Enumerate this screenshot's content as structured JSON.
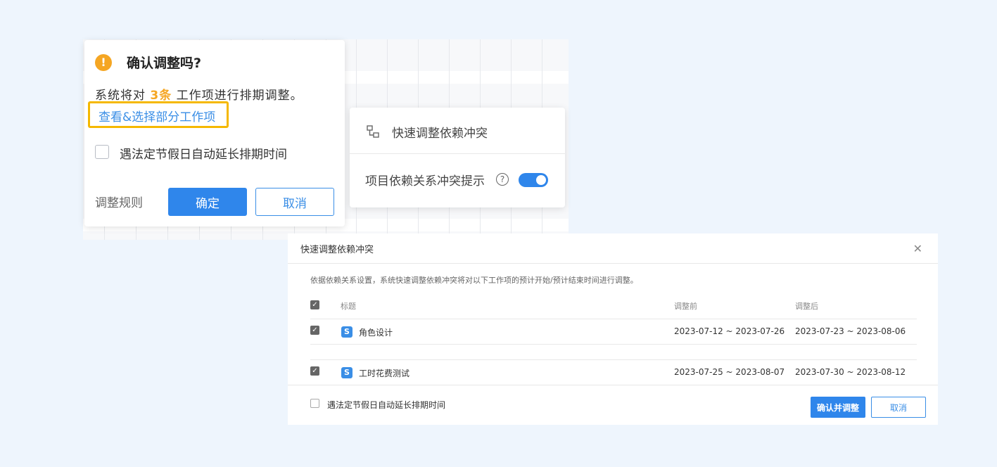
{
  "confirm_popover": {
    "title": "确认调整吗?",
    "warn_icon": "!",
    "message_prefix": "系统将对",
    "count": "3条",
    "message_suffix": "工作项进行排期调整。",
    "view_select_link": "查看&选择部分工作项",
    "holiday_extend_label": "遇法定节假日自动延长排期时间",
    "holiday_extend_checked": false,
    "rules_label": "调整规则",
    "ok_button": "确定",
    "cancel_button": "取消"
  },
  "quick_menu": {
    "item_label": "快速调整依赖冲突",
    "item_icon": "dependency-icon",
    "toggle_label": "项目依赖关系冲突提示",
    "help_icon_glyph": "?",
    "toggle_on": true
  },
  "dialog": {
    "title": "快速调整依赖冲突",
    "close_glyph": "✕",
    "description": "依据依赖关系设置，系统快速调整依赖冲突将对以下工作项的预计开始/预计结束时间进行调整。",
    "columns": {
      "title": "标题",
      "before": "调整前",
      "after": "调整后"
    },
    "rows": [
      {
        "checked": true,
        "type_badge": "S",
        "title": "角色设计",
        "before": "2023-07-12 ~ 2023-07-26",
        "after": "2023-07-23 ~ 2023-08-06"
      },
      {
        "checked": true,
        "type_badge": "S",
        "title": "工时花费测试",
        "before": "2023-07-25 ~ 2023-08-07",
        "after": "2023-07-30 ~ 2023-08-12"
      }
    ],
    "footer_holiday_label": "遇法定节假日自动延长排期时间",
    "footer_holiday_checked": false,
    "apply_button": "确认并调整",
    "cancel_button": "取消"
  },
  "colors": {
    "accent": "#2f86eb",
    "warning": "#f5a623",
    "highlight_box": "#f5b800",
    "background": "#eef5fd"
  }
}
